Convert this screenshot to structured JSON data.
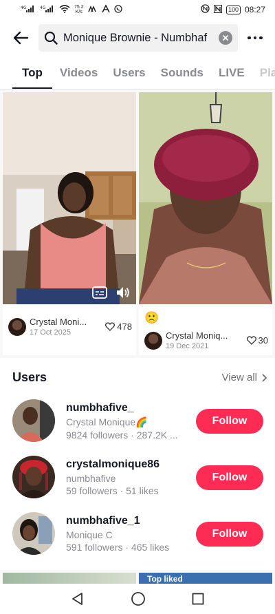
{
  "status_bar": {
    "signal_1": "4G",
    "signal_2": "4G",
    "speed_value": "75.2",
    "speed_unit": "K/s",
    "battery": "100",
    "time": "08:27"
  },
  "search": {
    "query": "Monique Brownie - Numbhaf"
  },
  "tabs": [
    "Top",
    "Videos",
    "Users",
    "Sounds",
    "LIVE",
    "Pla"
  ],
  "videos": [
    {
      "author": "Crystal Moni...",
      "date": "17 Oct 2025",
      "likes": "478",
      "caption": ""
    },
    {
      "author": "Crystal Moniq...",
      "date": "19 Dec 2021",
      "likes": "30",
      "caption": "🙁"
    }
  ],
  "users_section": {
    "title": "Users",
    "view_all": "View all"
  },
  "users": [
    {
      "handle": "numbhafive_",
      "nickname": "Crystal Monique🌈",
      "stats": "9824 followers · 287.2K ...",
      "follow_label": "Follow"
    },
    {
      "handle": "crystalmonique86",
      "nickname": "numbhafive",
      "stats": "59 followers · 51 likes",
      "follow_label": "Follow"
    },
    {
      "handle": "numbhafive_1",
      "nickname": "Monique C",
      "stats": "591 followers · 465 likes",
      "follow_label": "Follow"
    }
  ],
  "peek": {
    "right_label": "Top liked"
  },
  "colors": {
    "accent": "#fe2c55",
    "text_primary": "#161823",
    "text_secondary": "#8a8b91"
  },
  "icons": [
    "back-arrow-icon",
    "search-icon",
    "clear-icon",
    "more-icon",
    "caption-icon",
    "volume-icon",
    "heart-icon",
    "chevron-right-icon",
    "nav-back-icon",
    "nav-home-icon",
    "nav-recents-icon"
  ]
}
